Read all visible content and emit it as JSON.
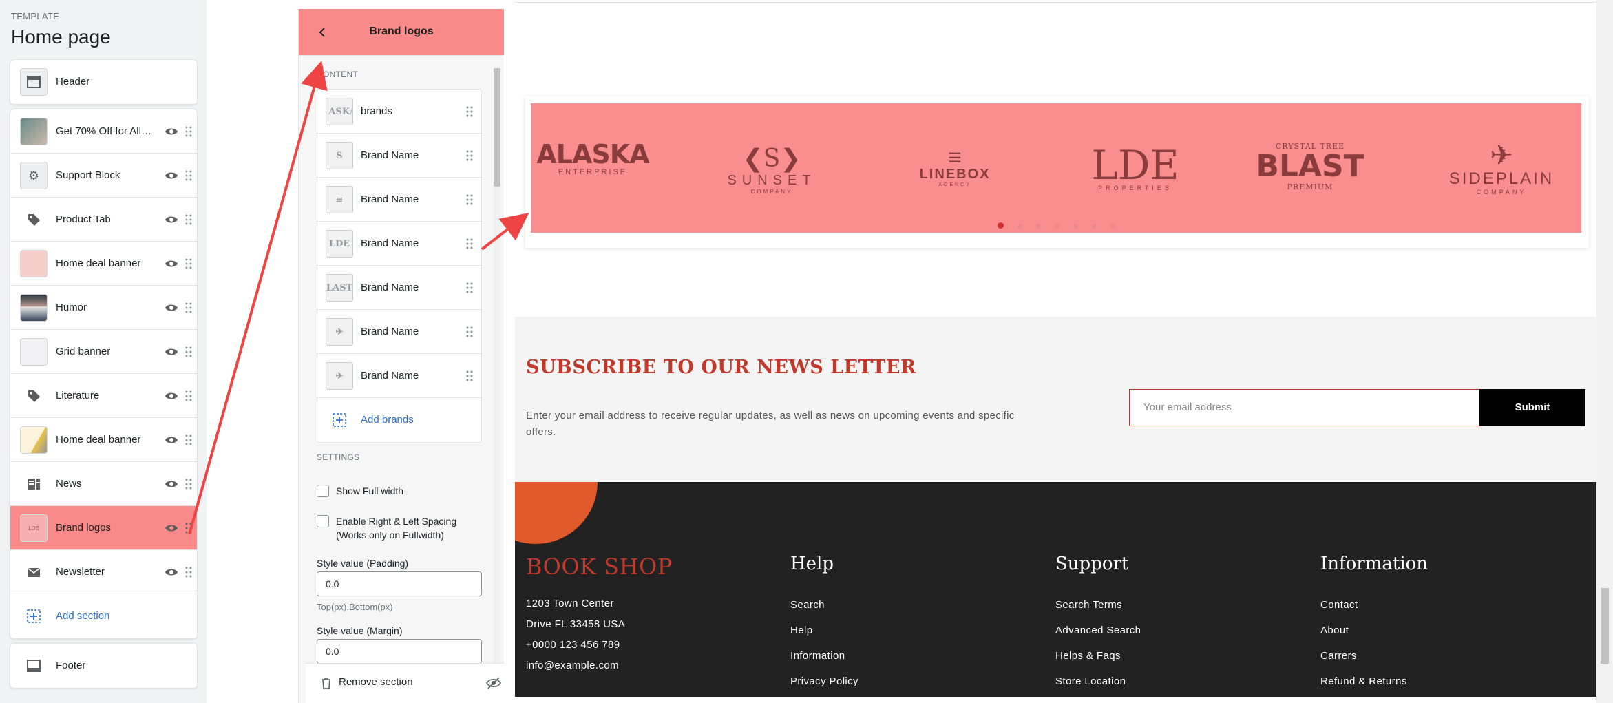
{
  "sidebar": {
    "template_label": "TEMPLATE",
    "title": "Home page",
    "header_item": "Header",
    "items": [
      {
        "label": "Get 70% Off for All ...",
        "icon": "image-thumbnail"
      },
      {
        "label": "Support Block",
        "icon": "support-thumbnail"
      },
      {
        "label": "Product Tab",
        "icon": "tag-icon"
      },
      {
        "label": "Home deal banner",
        "icon": "image-thumbnail"
      },
      {
        "label": "Humor",
        "icon": "image-thumbnail"
      },
      {
        "label": "Grid banner",
        "icon": "image-thumbnail"
      },
      {
        "label": "Literature",
        "icon": "tag-icon"
      },
      {
        "label": "Home deal banner",
        "icon": "image-thumbnail"
      },
      {
        "label": "News",
        "icon": "blog-icon"
      },
      {
        "label": "Brand logos",
        "icon": "image-thumbnail"
      },
      {
        "label": "Newsletter",
        "icon": "mail-icon"
      }
    ],
    "add_section": "Add section",
    "footer_item": "Footer",
    "accent": "#fa8a8a"
  },
  "panel": {
    "title": "Brand logos",
    "content_label": "CONTENT",
    "blocks": [
      {
        "label": "brands",
        "thumb": "LASKA"
      },
      {
        "label": "Brand Name",
        "thumb": "S"
      },
      {
        "label": "Brand Name",
        "thumb": "≡"
      },
      {
        "label": "Brand Name",
        "thumb": "LDE"
      },
      {
        "label": "Brand Name",
        "thumb": "LAST"
      },
      {
        "label": "Brand Name",
        "thumb": "✈"
      },
      {
        "label": "Brand Name",
        "thumb": "✈"
      }
    ],
    "add_brands": "Add brands",
    "settings_label": "SETTINGS",
    "show_full_width": "Show Full width",
    "enable_spacing": "Enable Right & Left Spacing",
    "enable_spacing_note": "(Works only on Fullwidth)",
    "padding_label": "Style value (Padding)",
    "padding_value": "0.0",
    "padding_help": "Top(px),Bottom(px)",
    "margin_label": "Style value (Margin)",
    "margin_value": "0.0",
    "remove_section": "Remove section"
  },
  "preview": {
    "brands": [
      {
        "name": "ALASKA",
        "sub": "ENTERPRISE"
      },
      {
        "name": "SUNSET",
        "sub": "COMPANY"
      },
      {
        "name": "LINEBOX",
        "sub": "AGENCY"
      },
      {
        "name": "LDE",
        "sub": "PROPERTIES"
      },
      {
        "name": "BLAST",
        "sub": "PREMIUM",
        "top": "CRYSTAL TREE"
      },
      {
        "name": "SIDEPLAIN",
        "sub": "COMPANY"
      }
    ],
    "newsletter": {
      "heading": "SUBSCRIBE TO OUR NEWS LETTER",
      "text": "Enter your email address to receive regular updates, as well as news on upcoming events and specific offers.",
      "placeholder": "Your email address",
      "submit": "Submit"
    },
    "footer": {
      "brand": "BOOK SHOP",
      "address": [
        "1203 Town Center",
        "Drive FL 33458 USA",
        "+0000 123 456 789",
        "info@example.com"
      ],
      "help_title": "Help",
      "help": [
        "Search",
        "Help",
        "Information",
        "Privacy Policy"
      ],
      "support_title": "Support",
      "support": [
        "Search Terms",
        "Advanced Search",
        "Helps & Faqs",
        "Store Location"
      ],
      "info_title": "Information",
      "info": [
        "Contact",
        "About",
        "Carrers",
        "Refund & Returns"
      ]
    },
    "accent_red": "#c0392b"
  }
}
